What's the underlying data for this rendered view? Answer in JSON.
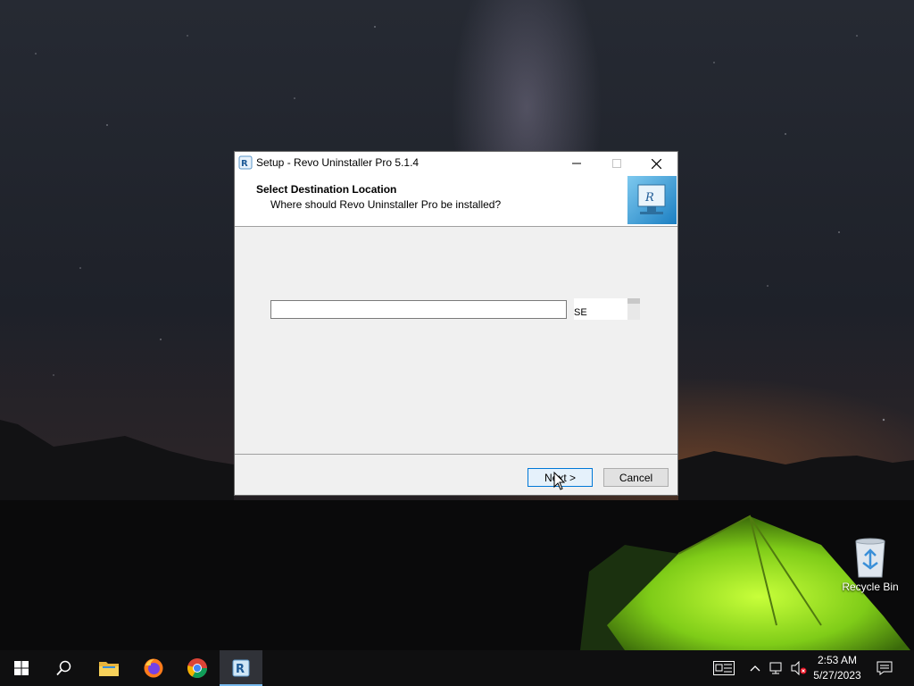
{
  "desktop": {
    "recycle_bin_label": "Recycle Bin"
  },
  "dialog": {
    "title": "Setup - Revo Uninstaller Pro 5.1.4",
    "header_title": "Select Destination Location",
    "header_subtitle": "Where should Revo Uninstaller Pro be installed?",
    "path_value": "",
    "browse_label": "SE",
    "next_label": "Next >",
    "cancel_label": "Cancel"
  },
  "taskbar": {
    "time": "2:53 AM",
    "date": "5/27/2023",
    "accent": "#76b9ed",
    "apps": [
      "start-icon",
      "search-icon",
      "file-explorer-icon",
      "firefox-icon",
      "chrome-icon",
      "revo-uninstaller-icon"
    ]
  }
}
